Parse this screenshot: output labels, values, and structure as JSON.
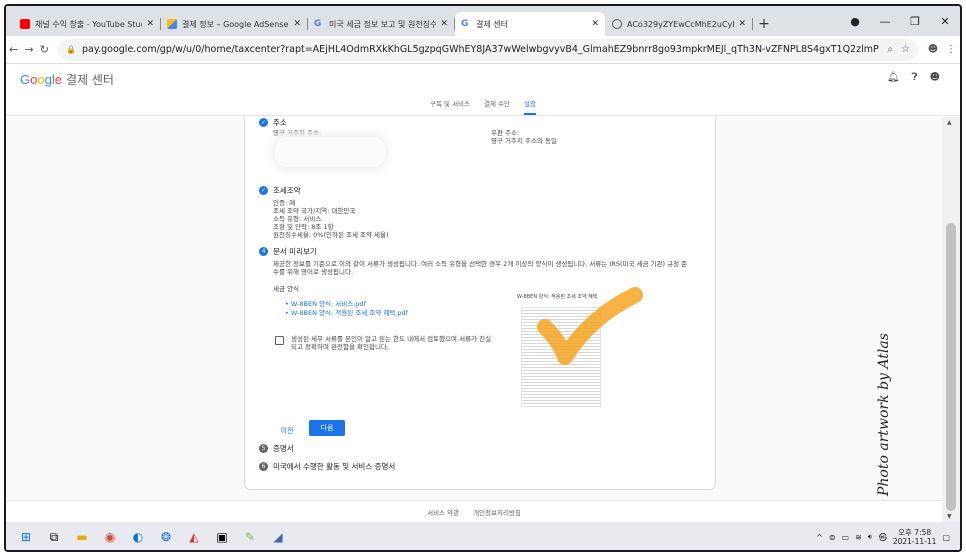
{
  "tabs": [
    {
      "label": "채널 수익 창출 - YouTube Studio",
      "icon": "youtube-icon",
      "active": false
    },
    {
      "label": "결제 정보 – Google AdSense",
      "icon": "adsense-icon",
      "active": false
    },
    {
      "label": "미국 세금 정보 보고 및 원천징수",
      "icon": "google-icon",
      "active": false
    },
    {
      "label": "결제 센터",
      "icon": "google-icon",
      "active": true
    },
    {
      "label": "ACo329yZYEwCcMhE2uCyPSlpf",
      "icon": "globe-icon",
      "active": false
    }
  ],
  "address_bar": {
    "url": "pay.google.com/gp/w/u/0/home/taxcenter?rapt=AEjHL4OdmRXkKhGL5gzpqGWhEY8JA37wWelwbgvyvB4_GlmahEZ9bnrr8go93mpkrMEJl_qTh3N-vZFNPL8S4gxT1Q2zlmP0TYpHV4eAhbi5Tfe-NB2h1..."
  },
  "app": {
    "logo": "Google",
    "title": "결제 센터"
  },
  "subnav": [
    "구독 및 서비스",
    "결제 수단",
    "설정"
  ],
  "address_section": {
    "title": "주소",
    "permanent_label": "영구 거주지 주소:",
    "mailing_label": "우편 주소:",
    "mailing_value": "영구 거주지 주소와 동일"
  },
  "treaty_section": {
    "title": "조세조약",
    "lines": [
      "인증: 예",
      "조세 조약 국가/지역: 대한민국",
      "소득 유형: 서비스",
      "조항 및 단락: 8조 1항",
      "원천징수세율: 0%(인하된 조세 조약 세율)"
    ]
  },
  "preview_section": {
    "number": "4",
    "title": "문서 미리보기",
    "desc_1": "제공한 정보를 기준으로 이와 같이 서류가 생성됩니다. 여러 소득 유형을 선택한 경우 2개 이상의 양식이 생성됩니다. 서류는 IRS(미국 세금 기관) 규정 준",
    "desc_2": "수를 위해 영어로 생성됩니다.",
    "forms_label": "세금 양식",
    "forms": [
      "W-8BEN 양식: 서비스.pdf",
      "W-8BEN 양식: 적용된 조세 조약 혜택.pdf"
    ],
    "preview_caption": "W-8BEN 양식: 적용된 조세 조약 혜택",
    "confirm_1": "생성된 세무 서류를 본인이 알고 믿는 한도 내에서 검토했으며 서류가 진실",
    "confirm_2": "되고 정확하며 완전함을 확인합니다.",
    "prev_button": "이전",
    "next_button": "다음"
  },
  "step5": {
    "number": "5",
    "title": "증명서"
  },
  "step6": {
    "number": "6",
    "title": "미국에서 수행한 활동 및 서비스 증명서"
  },
  "footer": [
    "서비스 약관",
    "개인정보처리방침"
  ],
  "taskbar": {
    "time": "오후 7:58",
    "date": "2021-11-11"
  },
  "watermark": "Photo artwork by Atlas"
}
